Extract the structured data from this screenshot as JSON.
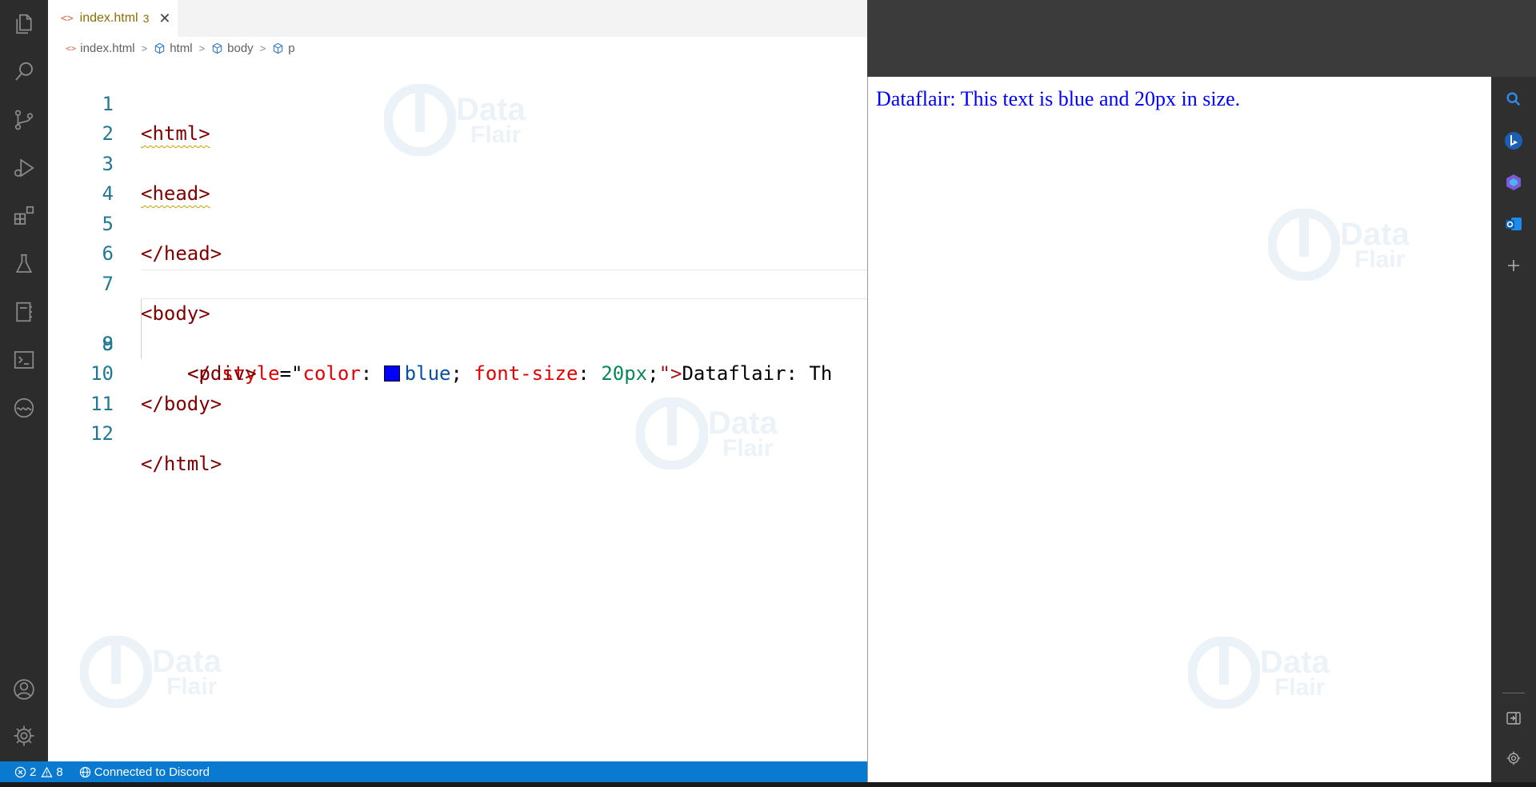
{
  "editor": {
    "tab": {
      "label": "index.html",
      "problem_count": "3",
      "close_glyph": "✕"
    },
    "breadcrumb": [
      "index.html",
      "html",
      "body",
      "p"
    ],
    "lines": [
      {
        "num": "1"
      },
      {
        "num": "2"
      },
      {
        "num": "3"
      },
      {
        "num": "4"
      },
      {
        "num": "5"
      },
      {
        "num": "6"
      },
      {
        "num": "7"
      },
      {
        "num": "8"
      },
      {
        "num": "9"
      },
      {
        "num": "10"
      },
      {
        "num": "11"
      },
      {
        "num": "12"
      }
    ],
    "code": {
      "l1": "<html>",
      "l3": "<head>",
      "l5": "</head>",
      "l7": "<body>",
      "l8_open": "<p ",
      "l8_attr1": "style",
      "l8_eq": "=\"",
      "l8_prop1": "color",
      "l8_colon1": ": ",
      "l8_val1": "blue",
      "l8_semi1": "; ",
      "l8_prop2": "font-size",
      "l8_colon2": ": ",
      "l8_val2": "20px",
      "l8_semi2": ";",
      "l8_close": "\">",
      "l8_text": "Dataflair: Th",
      "l9": "</div>",
      "l10": "</body>",
      "l12": "</html>"
    },
    "swatch_color": "#0000ff"
  },
  "watermark": {
    "line1": "Data",
    "line2": "Flair"
  },
  "preview": {
    "text": "Dataflair: This text is blue and 20px in size.",
    "text_color": "#0000ff"
  },
  "status_bar": {
    "errors": "2",
    "warnings": "8",
    "discord": "Connected to Discord",
    "color": "#0a7ad1"
  },
  "activity_icons": [
    "explorer-icon",
    "search-icon",
    "source-control-icon",
    "run-debug-icon",
    "extensions-icon",
    "testing-icon",
    "notebook-icon",
    "terminal-icon",
    "live-share-icon",
    "account-icon",
    "settings-gear-icon"
  ],
  "sidebar_icons": [
    "search-icon",
    "bing-icon",
    "copilot-icon",
    "outlook-icon",
    "add-icon",
    "panel-toggle-icon",
    "settings-icon"
  ]
}
